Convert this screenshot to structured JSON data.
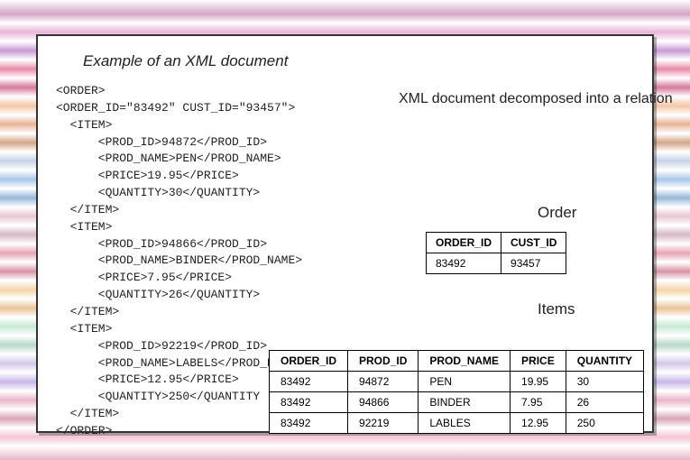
{
  "title": "Example of an XML document",
  "xml_lines": [
    "<ORDER>",
    "<ORDER_ID=\"83492\" CUST_ID=\"93457\">",
    "  <ITEM>",
    "      <PROD_ID>94872</PROD_ID>",
    "      <PROD_NAME>PEN</PROD_NAME>",
    "      <PRICE>19.95</PRICE>",
    "      <QUANTITY>30</QUANTITY>",
    "  </ITEM>",
    "  <ITEM>",
    "      <PROD_ID>94866</PROD_ID>",
    "      <PROD_NAME>BINDER</PROD_NAME>",
    "      <PRICE>7.95</PRICE>",
    "      <QUANTITY>26</QUANTITY>",
    "  </ITEM>",
    "  <ITEM>",
    "      <PROD_ID>92219</PROD_ID>",
    "      <PROD_NAME>LABELS</PROD_NAME>",
    "      <PRICE>12.95</PRICE>",
    "      <QUANTITY>250</QUANTITY",
    "  </ITEM>",
    "</ORDER>"
  ],
  "annotation": "XML document decomposed into a relation",
  "order_label": "Order",
  "items_label": "Items",
  "order_table": {
    "headers": [
      "ORDER_ID",
      "CUST_ID"
    ],
    "rows": [
      [
        "83492",
        "93457"
      ]
    ]
  },
  "items_table": {
    "headers": [
      "ORDER_ID",
      "PROD_ID",
      "PROD_NAME",
      "PRICE",
      "QUANTITY"
    ],
    "rows": [
      [
        "83492",
        "94872",
        "PEN",
        "19.95",
        "30"
      ],
      [
        "83492",
        "94866",
        "BINDER",
        "7.95",
        "26"
      ],
      [
        "83492",
        "92219",
        "LABLES",
        "12.95",
        "250"
      ]
    ]
  }
}
